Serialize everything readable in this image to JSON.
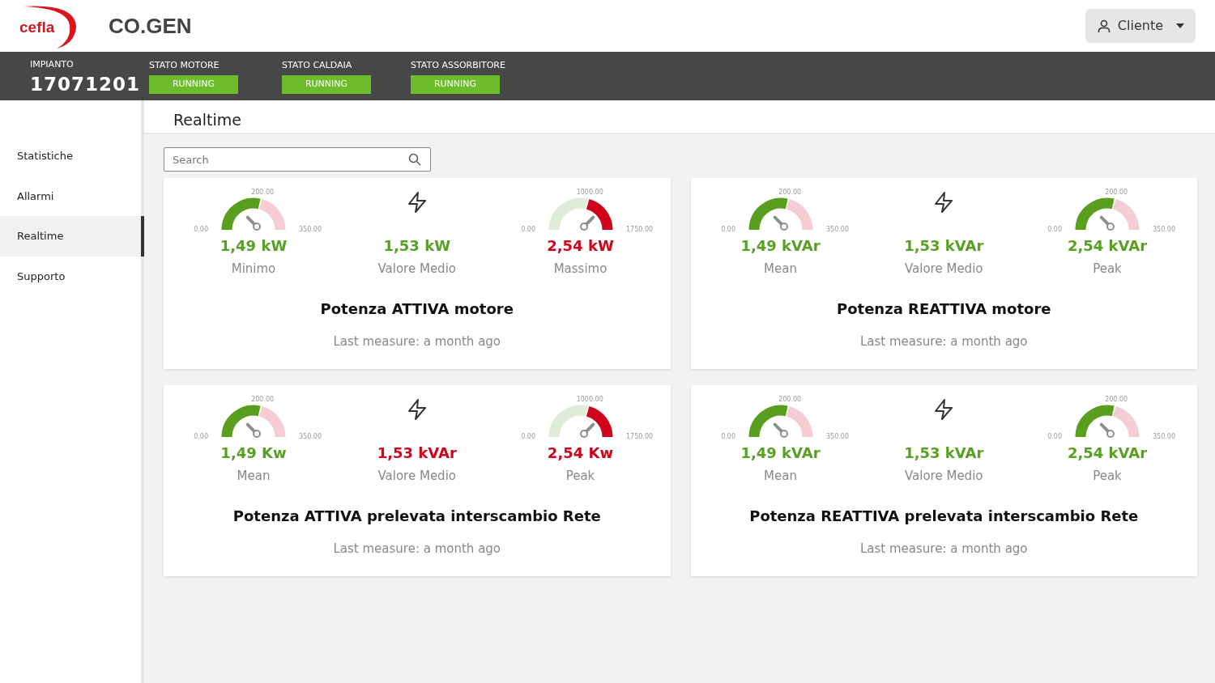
{
  "header": {
    "logo": "cefla",
    "app_title": "CO.GEN",
    "user_menu": "Cliente"
  },
  "status_bar": {
    "plant_label": "IMPIANTO",
    "plant_id": "17071201",
    "states": [
      {
        "label": "STATO MOTORE",
        "value": "RUNNING",
        "active": true
      },
      {
        "label": "STATO CALDAIA",
        "value": "RUNNING",
        "active": true
      },
      {
        "label": "STATO ASSORBITORE",
        "value": "RUNNING",
        "active": true
      }
    ]
  },
  "sidebar": {
    "items": [
      {
        "label": "Statistiche",
        "selected": false
      },
      {
        "label": "Allarmi",
        "selected": false
      },
      {
        "label": "Realtime",
        "selected": true
      },
      {
        "label": "Supporto",
        "selected": false
      }
    ]
  },
  "page_title": "Realtime",
  "search": {
    "placeholder": "Search"
  },
  "cards": [
    {
      "title": "Potenza ATTIVA motore",
      "last_measure": "Last measure: a month ago",
      "min": {
        "kind": "normal",
        "tick_min": "0.00",
        "tick_mid": "200.00",
        "tick_max": "350.00",
        "value": "1,49 kW",
        "alarm": false,
        "caption": "Minimo"
      },
      "average": {
        "value": "1,53 kW",
        "alarm": false,
        "caption": "Valore Medio"
      },
      "max": {
        "kind": "alert",
        "tick_min": "0.00",
        "tick_mid": "1000.00",
        "tick_max": "1750.00",
        "value": "2,54 kW",
        "alarm": true,
        "caption": "Massimo"
      }
    },
    {
      "title": "Potenza REATTIVA motore",
      "last_measure": "Last measure: a month ago",
      "min": {
        "kind": "normal",
        "tick_min": "0.00",
        "tick_mid": "200.00",
        "tick_max": "350.00",
        "value": "1,49 kVAr",
        "alarm": false,
        "caption": "Mean"
      },
      "average": {
        "value": "1,53 kVAr",
        "alarm": false,
        "caption": "Valore Medio"
      },
      "max": {
        "kind": "normal",
        "tick_min": "0.00",
        "tick_mid": "200.00",
        "tick_max": "350.00",
        "value": "2,54 kVAr",
        "alarm": false,
        "caption": "Peak"
      }
    },
    {
      "title": "Potenza ATTIVA prelevata interscambio Rete",
      "last_measure": "Last measure: a month ago",
      "min": {
        "kind": "normal",
        "tick_min": "0.00",
        "tick_mid": "200.00",
        "tick_max": "350.00",
        "value": "1,49 Kw",
        "alarm": false,
        "caption": "Mean"
      },
      "average": {
        "value": "1,53 kVAr",
        "alarm": true,
        "caption": "Valore Medio"
      },
      "max": {
        "kind": "alert",
        "tick_min": "0.00",
        "tick_mid": "1000.00",
        "tick_max": "1750.00",
        "value": "2,54 Kw",
        "alarm": true,
        "caption": "Peak"
      }
    },
    {
      "title": "Potenza REATTIVA prelevata interscambio Rete",
      "last_measure": "Last measure: a month ago",
      "min": {
        "kind": "normal",
        "tick_min": "0.00",
        "tick_mid": "200.00",
        "tick_max": "350.00",
        "value": "1,49 kVAr",
        "alarm": false,
        "caption": "Mean"
      },
      "average": {
        "value": "1,53 kVAr",
        "alarm": false,
        "caption": "Valore Medio"
      },
      "max": {
        "kind": "normal",
        "tick_min": "0.00",
        "tick_mid": "200.00",
        "tick_max": "350.00",
        "value": "2,54 kVAr",
        "alarm": false,
        "caption": "Peak"
      }
    }
  ]
}
